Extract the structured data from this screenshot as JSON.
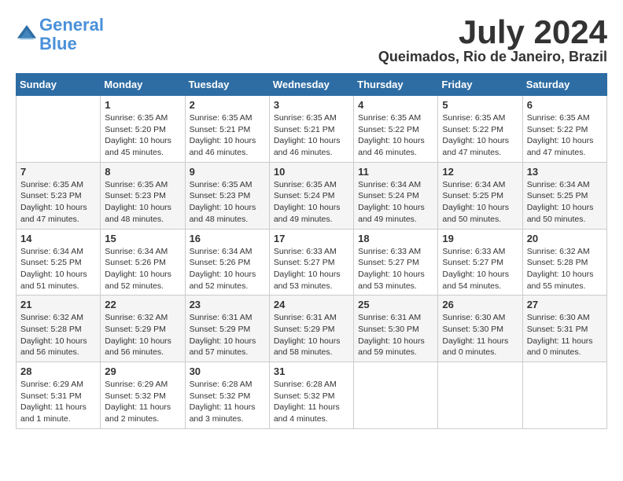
{
  "logo": {
    "line1": "General",
    "line2": "Blue"
  },
  "title": "July 2024",
  "location": "Queimados, Rio de Janeiro, Brazil",
  "weekdays": [
    "Sunday",
    "Monday",
    "Tuesday",
    "Wednesday",
    "Thursday",
    "Friday",
    "Saturday"
  ],
  "weeks": [
    [
      {
        "day": "",
        "info": ""
      },
      {
        "day": "1",
        "info": "Sunrise: 6:35 AM\nSunset: 5:20 PM\nDaylight: 10 hours\nand 45 minutes."
      },
      {
        "day": "2",
        "info": "Sunrise: 6:35 AM\nSunset: 5:21 PM\nDaylight: 10 hours\nand 46 minutes."
      },
      {
        "day": "3",
        "info": "Sunrise: 6:35 AM\nSunset: 5:21 PM\nDaylight: 10 hours\nand 46 minutes."
      },
      {
        "day": "4",
        "info": "Sunrise: 6:35 AM\nSunset: 5:22 PM\nDaylight: 10 hours\nand 46 minutes."
      },
      {
        "day": "5",
        "info": "Sunrise: 6:35 AM\nSunset: 5:22 PM\nDaylight: 10 hours\nand 47 minutes."
      },
      {
        "day": "6",
        "info": "Sunrise: 6:35 AM\nSunset: 5:22 PM\nDaylight: 10 hours\nand 47 minutes."
      }
    ],
    [
      {
        "day": "7",
        "info": "Sunrise: 6:35 AM\nSunset: 5:23 PM\nDaylight: 10 hours\nand 47 minutes."
      },
      {
        "day": "8",
        "info": "Sunrise: 6:35 AM\nSunset: 5:23 PM\nDaylight: 10 hours\nand 48 minutes."
      },
      {
        "day": "9",
        "info": "Sunrise: 6:35 AM\nSunset: 5:23 PM\nDaylight: 10 hours\nand 48 minutes."
      },
      {
        "day": "10",
        "info": "Sunrise: 6:35 AM\nSunset: 5:24 PM\nDaylight: 10 hours\nand 49 minutes."
      },
      {
        "day": "11",
        "info": "Sunrise: 6:34 AM\nSunset: 5:24 PM\nDaylight: 10 hours\nand 49 minutes."
      },
      {
        "day": "12",
        "info": "Sunrise: 6:34 AM\nSunset: 5:25 PM\nDaylight: 10 hours\nand 50 minutes."
      },
      {
        "day": "13",
        "info": "Sunrise: 6:34 AM\nSunset: 5:25 PM\nDaylight: 10 hours\nand 50 minutes."
      }
    ],
    [
      {
        "day": "14",
        "info": "Sunrise: 6:34 AM\nSunset: 5:25 PM\nDaylight: 10 hours\nand 51 minutes."
      },
      {
        "day": "15",
        "info": "Sunrise: 6:34 AM\nSunset: 5:26 PM\nDaylight: 10 hours\nand 52 minutes."
      },
      {
        "day": "16",
        "info": "Sunrise: 6:34 AM\nSunset: 5:26 PM\nDaylight: 10 hours\nand 52 minutes."
      },
      {
        "day": "17",
        "info": "Sunrise: 6:33 AM\nSunset: 5:27 PM\nDaylight: 10 hours\nand 53 minutes."
      },
      {
        "day": "18",
        "info": "Sunrise: 6:33 AM\nSunset: 5:27 PM\nDaylight: 10 hours\nand 53 minutes."
      },
      {
        "day": "19",
        "info": "Sunrise: 6:33 AM\nSunset: 5:27 PM\nDaylight: 10 hours\nand 54 minutes."
      },
      {
        "day": "20",
        "info": "Sunrise: 6:32 AM\nSunset: 5:28 PM\nDaylight: 10 hours\nand 55 minutes."
      }
    ],
    [
      {
        "day": "21",
        "info": "Sunrise: 6:32 AM\nSunset: 5:28 PM\nDaylight: 10 hours\nand 56 minutes."
      },
      {
        "day": "22",
        "info": "Sunrise: 6:32 AM\nSunset: 5:29 PM\nDaylight: 10 hours\nand 56 minutes."
      },
      {
        "day": "23",
        "info": "Sunrise: 6:31 AM\nSunset: 5:29 PM\nDaylight: 10 hours\nand 57 minutes."
      },
      {
        "day": "24",
        "info": "Sunrise: 6:31 AM\nSunset: 5:29 PM\nDaylight: 10 hours\nand 58 minutes."
      },
      {
        "day": "25",
        "info": "Sunrise: 6:31 AM\nSunset: 5:30 PM\nDaylight: 10 hours\nand 59 minutes."
      },
      {
        "day": "26",
        "info": "Sunrise: 6:30 AM\nSunset: 5:30 PM\nDaylight: 11 hours\nand 0 minutes."
      },
      {
        "day": "27",
        "info": "Sunrise: 6:30 AM\nSunset: 5:31 PM\nDaylight: 11 hours\nand 0 minutes."
      }
    ],
    [
      {
        "day": "28",
        "info": "Sunrise: 6:29 AM\nSunset: 5:31 PM\nDaylight: 11 hours\nand 1 minute."
      },
      {
        "day": "29",
        "info": "Sunrise: 6:29 AM\nSunset: 5:32 PM\nDaylight: 11 hours\nand 2 minutes."
      },
      {
        "day": "30",
        "info": "Sunrise: 6:28 AM\nSunset: 5:32 PM\nDaylight: 11 hours\nand 3 minutes."
      },
      {
        "day": "31",
        "info": "Sunrise: 6:28 AM\nSunset: 5:32 PM\nDaylight: 11 hours\nand 4 minutes."
      },
      {
        "day": "",
        "info": ""
      },
      {
        "day": "",
        "info": ""
      },
      {
        "day": "",
        "info": ""
      }
    ]
  ]
}
